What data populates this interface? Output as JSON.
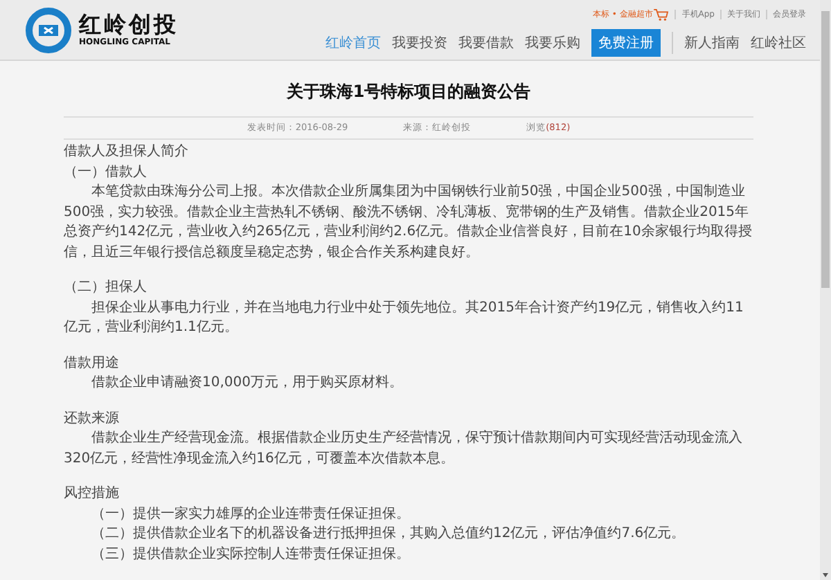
{
  "header": {
    "logo": {
      "name": "红岭创投",
      "subtitle": "HONGLING CAPITAL"
    },
    "top_links": [
      {
        "kind": "market",
        "text": "本标 • 金融超市"
      },
      {
        "kind": "link",
        "text": "手机App"
      },
      {
        "kind": "link",
        "text": "关于我们"
      },
      {
        "kind": "link",
        "text": "会员登录"
      }
    ],
    "nav": [
      {
        "kind": "link",
        "label": "红岭首页",
        "selected": true
      },
      {
        "kind": "link",
        "label": "我要投资",
        "selected": false
      },
      {
        "kind": "link",
        "label": "我要借款",
        "selected": false
      },
      {
        "kind": "link",
        "label": "我要乐购",
        "selected": false
      },
      {
        "kind": "register",
        "label": "免费注册",
        "selected": false
      },
      {
        "kind": "divider"
      },
      {
        "kind": "link",
        "label": "新人指南",
        "selected": false
      },
      {
        "kind": "link",
        "label": "红岭社区",
        "selected": false
      }
    ]
  },
  "article": {
    "title": "关于珠海1号特标项目的融资公告",
    "meta": {
      "published": "发表时间：2016-08-29",
      "source": "来源：红岭创投",
      "views_label": "浏览",
      "views_count": "(812)"
    },
    "sections": [
      {
        "heading": "借款人及担保人简介",
        "blocks": [
          {
            "kind": "subheading",
            "text": "（一）借款人"
          },
          {
            "kind": "paragraph",
            "text": "本笔贷款由珠海分公司上报。本次借款企业所属集团为中国钢铁行业前50强，中国企业500强，中国制造业500强，实力较强。借款企业主营热轧不锈钢、酸洗不锈钢、冷轧薄板、宽带钢的生产及销售。借款企业2015年总资产约142亿元，营业收入约265亿元，营业利润约2.6亿元。借款企业信誉良好，目前在10余家银行均取得授信，且近三年银行授信总额度呈稳定态势，银企合作关系构建良好。"
          },
          {
            "kind": "subheading",
            "text": "（二）担保人"
          },
          {
            "kind": "paragraph",
            "text": "担保企业从事电力行业，并在当地电力行业中处于领先地位。其2015年合计资产约19亿元，销售收入约11亿元，营业利润约1.1亿元。"
          }
        ]
      },
      {
        "heading": "借款用途",
        "blocks": [
          {
            "kind": "paragraph",
            "text": "借款企业申请融资10,000万元，用于购买原材料。"
          }
        ]
      },
      {
        "heading": "还款来源",
        "blocks": [
          {
            "kind": "paragraph",
            "text": "借款企业生产经营现金流。根据借款企业历史生产经营情况，保守预计借款期间内可实现经营活动现金流入320亿元，经营性净现金流入约16亿元，可覆盖本次借款本息。"
          }
        ]
      },
      {
        "heading": "风控措施",
        "blocks": [
          {
            "kind": "item",
            "text": "（一）提供一家实力雄厚的企业连带责任保证担保。"
          },
          {
            "kind": "item",
            "text": "（二）提供借款企业名下的机器设备进行抵押担保，其购入总值约12亿元，评估净值约7.6亿元。"
          },
          {
            "kind": "item",
            "text": "（三）提供借款企业实际控制人连带责任保证担保。"
          }
        ]
      }
    ]
  }
}
